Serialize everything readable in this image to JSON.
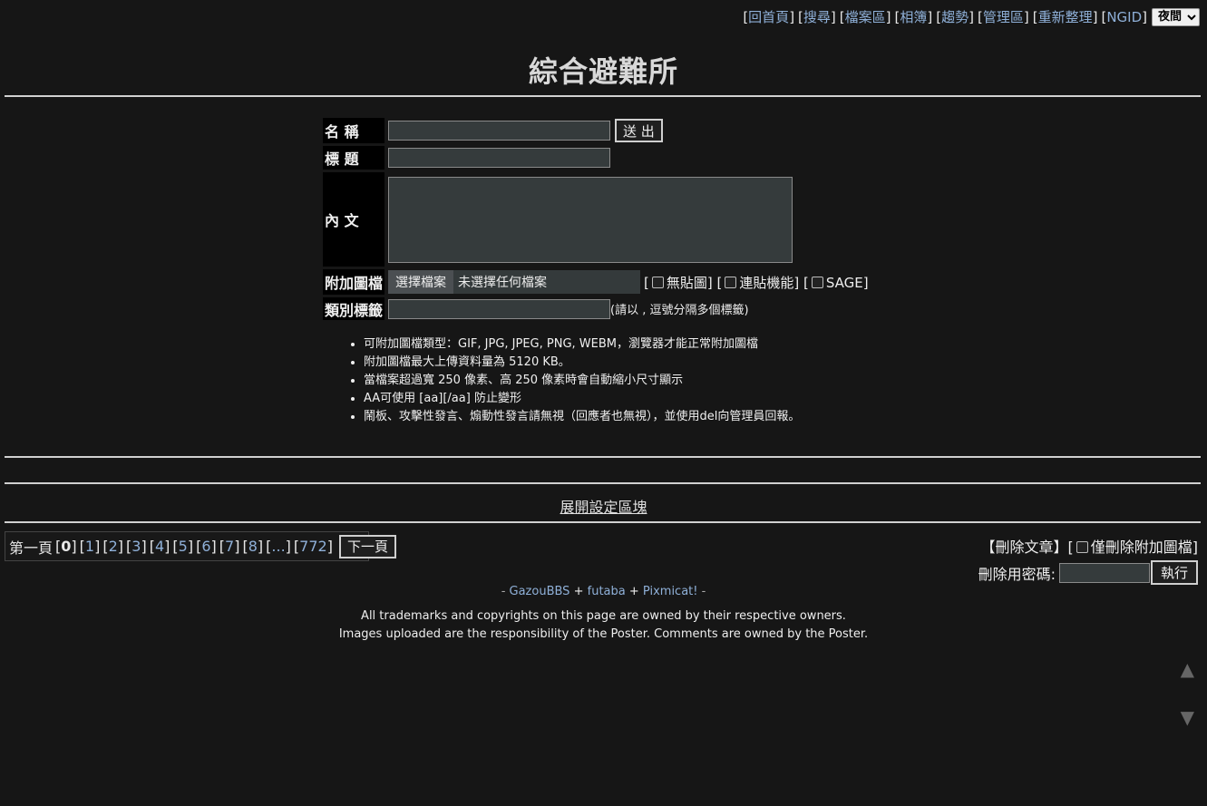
{
  "nav": {
    "links": [
      "回首頁",
      "搜尋",
      "檔案區",
      "相簿",
      "趨勢",
      "管理區",
      "重新整理",
      "NGID"
    ],
    "theme_selected": "夜間"
  },
  "title": "綜合避難所",
  "form": {
    "name_label": "名 稱",
    "subject_label": "標 題",
    "body_label": "內 文",
    "attach_label": "附加圖檔",
    "tags_label": "類別標籤",
    "submit_label": "送 出",
    "file_button": "選擇檔案",
    "file_status": "未選擇任何檔案",
    "opt_noimage": "無貼圖",
    "opt_continuous": "連貼機能",
    "opt_sage": "SAGE",
    "tags_hint": "(請以 , 逗號分隔多個標籤)"
  },
  "rules": [
    "可附加圖檔類型：GIF, JPG, JPEG, PNG, WEBM，瀏覽器才能正常附加圖檔",
    "附加圖檔最大上傳資料量為 5120 KB。",
    "當檔案超過寬 250 像素、高 250 像素時會自動縮小尺寸顯示",
    "AA可使用 [aa][/aa] 防止變形",
    "鬧板、攻擊性發言、煽動性發言請無視（回應者也無視），並使用del向管理員回報。"
  ],
  "expand_settings": "展開設定區塊",
  "pager": {
    "first_label": "第一頁",
    "current": "0",
    "pages": [
      "1",
      "2",
      "3",
      "4",
      "5",
      "6",
      "7",
      "8",
      "...",
      "772"
    ],
    "next_label": "下一頁"
  },
  "delete": {
    "title": "【刪除文章】",
    "image_only_label": "僅刪除附加圖檔",
    "password_label": "刪除用密碼:",
    "execute_label": "執行"
  },
  "footer": {
    "links": [
      "GazouBBS",
      "futaba",
      "Pixmicat!"
    ],
    "legal_line1": "All trademarks and copyrights on this page are owned by their respective owners.",
    "legal_line2": "Images uploaded are the responsibility of the Poster. Comments are owned by the Poster."
  },
  "scroll_up": "▲",
  "scroll_down": "▼"
}
